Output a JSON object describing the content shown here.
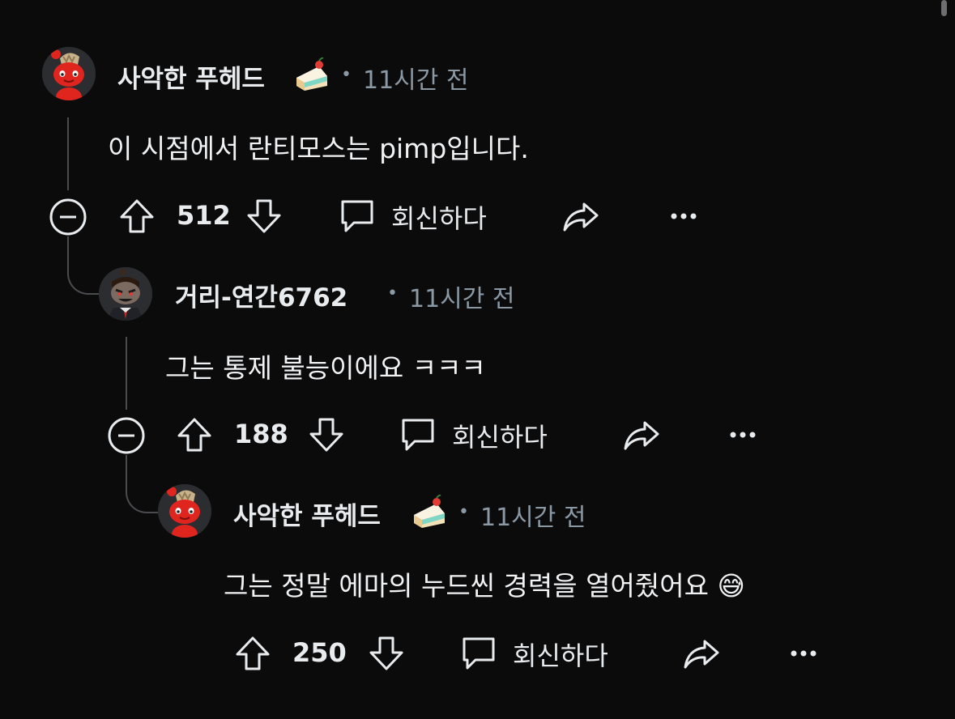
{
  "comments": [
    {
      "username": "사악한 푸헤드",
      "flair": "cake-icon",
      "time": "11시간 전",
      "body": "이 시점에서 란티모스는 pimp입니다.",
      "votes": "512",
      "reply_label": "회신하다",
      "collapsible": true
    },
    {
      "username": "거리-연간6762",
      "flair": "",
      "time": "11시간 전",
      "body": "그는 통제 불능이에요 ㅋㅋㅋ",
      "votes": "188",
      "reply_label": "회신하다",
      "collapsible": true
    },
    {
      "username": "사악한 푸헤드",
      "flair": "cake-icon",
      "time": "11시간 전",
      "body": "그는 정말 에마의 누드씬 경력을 열어줬어요",
      "body_emoji": "😅",
      "votes": "250",
      "reply_label": "회신하다",
      "collapsible": false
    }
  ],
  "separator": "•",
  "colors": {
    "background": "#0b0b0c",
    "text": "#eef1f3",
    "meta": "#8a99a4",
    "thread_line": "#4a4b4e",
    "avatar_red": "#e0251f"
  }
}
